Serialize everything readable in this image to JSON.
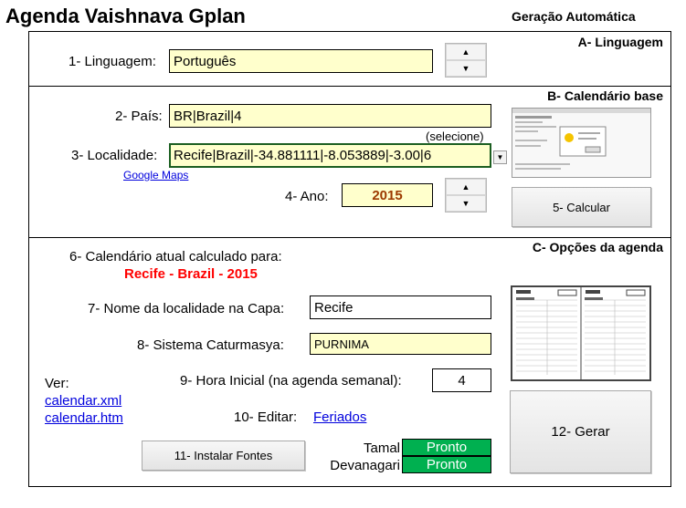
{
  "header": {
    "title": "Agenda Vaishnava Gplan",
    "mode": "Geração Automática"
  },
  "section_a": {
    "title": "A- Linguagem",
    "language_label": "1- Linguagem:",
    "language_value": "Português"
  },
  "section_b": {
    "title": "B- Calendário base",
    "country_label": "2- País:",
    "country_value": "BR|Brazil|4",
    "select_hint": "(selecione)",
    "locality_label": "3- Localidade:",
    "locality_value": "Recife|Brazil|-34.881111|-8.053889|-3.00|6",
    "maps_link": "Google Maps",
    "year_label": "4- Ano:",
    "year_value": "2015",
    "calculate_button": "5- Calcular"
  },
  "section_c": {
    "title": "C- Opções da agenda",
    "calc_label": "6- Calendário atual calculado para:",
    "calc_value": "Recife - Brazil - 2015",
    "cover_name_label": "7- Nome da localidade na Capa:",
    "cover_name_value": "Recife",
    "caturmasya_label": "8- Sistema Caturmasya:",
    "caturmasya_value": "PURNIMA",
    "start_hour_label": "9- Hora Inicial (na agenda semanal):",
    "start_hour_value": "4",
    "see_label": "Ver:",
    "calendar_xml_link": "calendar.xml",
    "calendar_htm_link": "calendar.htm",
    "edit_label": "10- Editar:",
    "holidays_link": "Feriados",
    "install_fonts_button": "11- Instalar Fontes",
    "fonts": [
      {
        "name": "Tamal",
        "status": "Pronto"
      },
      {
        "name": "Devanagari",
        "status": "Pronto"
      }
    ],
    "generate_button": "12- Gerar"
  },
  "colors": {
    "field_yellow": "#ffffcc",
    "accent_red": "#ff0000",
    "year_text": "#9c3a00",
    "status_green": "#00b050",
    "link_blue": "#0000dd"
  }
}
